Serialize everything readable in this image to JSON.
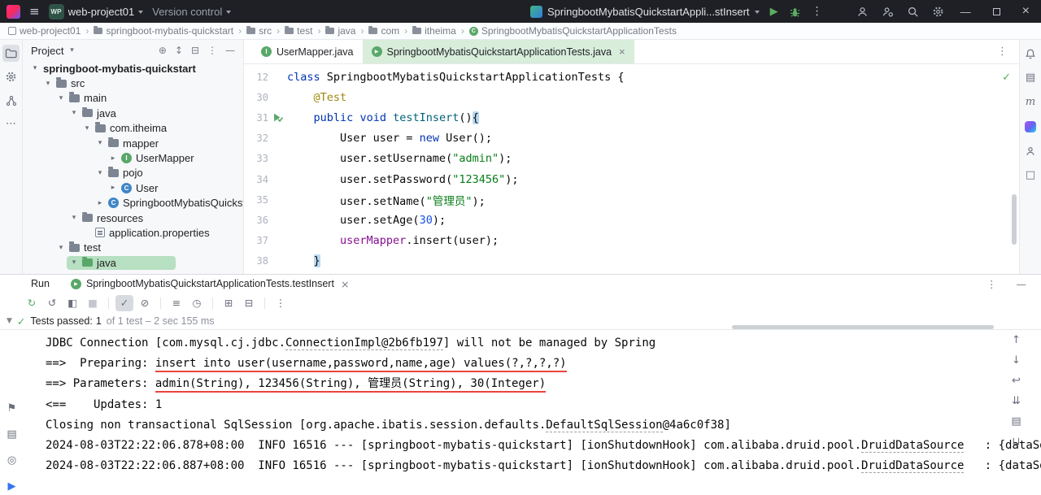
{
  "titlebar": {
    "project_badge": "WP",
    "project_name": "web-project01",
    "version_control": "Version control",
    "run_config": "SpringbootMybatisQuickstartAppli...stInsert"
  },
  "navbar": {
    "separator": "›",
    "items": [
      {
        "label": "web-project01",
        "icon": "project"
      },
      {
        "label": "springboot-mybatis-quickstart",
        "icon": "folder"
      },
      {
        "label": "src",
        "icon": "folder"
      },
      {
        "label": "test",
        "icon": "folder"
      },
      {
        "label": "java",
        "icon": "folder"
      },
      {
        "label": "com",
        "icon": "folder"
      },
      {
        "label": "itheima",
        "icon": "folder"
      },
      {
        "label": "SpringbootMybatisQuickstartApplicationTests",
        "icon": "class"
      }
    ]
  },
  "left_strip": [
    {
      "name": "project-tool",
      "active": true
    },
    {
      "name": "settings-tool"
    },
    {
      "name": "structure-tool"
    },
    {
      "name": "more-tools",
      "glyph": "⋯"
    }
  ],
  "bottom_rail": [
    {
      "name": "bookmarks",
      "glyph": "⚑"
    },
    {
      "name": "terminal",
      "glyph": "▤"
    },
    {
      "name": "services",
      "glyph": "◎"
    },
    {
      "name": "run-tool",
      "glyph": "▶",
      "cls": "blue"
    }
  ],
  "right_strip": [
    {
      "name": "notifications"
    },
    {
      "name": "layers",
      "glyph": "▤"
    },
    {
      "name": "maven",
      "glyph": "m",
      "cls": "serif"
    },
    {
      "name": "ai-assistant"
    },
    {
      "name": "profile"
    },
    {
      "name": "plugins",
      "glyph": "□"
    }
  ],
  "project": {
    "title": "Project",
    "header_icons": [
      {
        "name": "locate-file",
        "glyph": "⊕"
      },
      {
        "name": "expand-collapse",
        "glyph": "↕"
      },
      {
        "name": "collapse-all",
        "glyph": "⊟"
      },
      {
        "name": "more-options",
        "glyph": "⋮"
      },
      {
        "name": "hide-panel",
        "glyph": "—"
      }
    ],
    "tree": [
      {
        "label": "springboot-mybatis-quickstart",
        "indent": 0,
        "chevron": "open",
        "bold": true
      },
      {
        "label": "src",
        "indent": 1,
        "chevron": "open",
        "icon": "folder"
      },
      {
        "label": "main",
        "indent": 2,
        "chevron": "open",
        "icon": "folder"
      },
      {
        "label": "java",
        "indent": 3,
        "chevron": "open",
        "icon": "folder"
      },
      {
        "label": "com.itheima",
        "indent": 4,
        "chevron": "open",
        "icon": "folder"
      },
      {
        "label": "mapper",
        "indent": 5,
        "chevron": "open",
        "icon": "folder"
      },
      {
        "label": "UserMapper",
        "indent": 6,
        "chevron": "closed",
        "icon": "interface"
      },
      {
        "label": "pojo",
        "indent": 5,
        "chevron": "open",
        "icon": "folder"
      },
      {
        "label": "User",
        "indent": 6,
        "chevron": "closed",
        "icon": "class"
      },
      {
        "label": "SpringbootMybatisQuickst",
        "indent": 5,
        "chevron": "closed",
        "icon": "class"
      },
      {
        "label": "resources",
        "indent": 3,
        "chevron": "open",
        "icon": "folder"
      },
      {
        "label": "application.properties",
        "indent": 4,
        "icon": "properties"
      },
      {
        "label": "test",
        "indent": 2,
        "chevron": "open",
        "icon": "folder"
      },
      {
        "label": "java",
        "indent": 3,
        "chevron": "open",
        "icon": "folder-test",
        "selected": true
      }
    ]
  },
  "editor": {
    "tabs": [
      {
        "label": "UserMapper.java",
        "icon": "interface"
      },
      {
        "label": "SpringbootMybatisQuickstartApplicationTests.java",
        "icon": "testclass",
        "active": true,
        "close": "×"
      }
    ],
    "lines": [
      {
        "num": "12",
        "tokens": [
          {
            "t": "class",
            "c": "kw"
          },
          {
            "t": " SpringbootMybatisQuickstartApplicationTests {"
          }
        ]
      },
      {
        "num": "30",
        "tokens": [
          {
            "t": "    "
          },
          {
            "t": "@Test",
            "c": "ann"
          }
        ]
      },
      {
        "num": "31",
        "gutter": "run-pass",
        "tokens": [
          {
            "t": "    "
          },
          {
            "t": "public",
            "c": "kw"
          },
          {
            "t": " "
          },
          {
            "t": "void",
            "c": "kw"
          },
          {
            "t": " "
          },
          {
            "t": "testInsert",
            "c": "decl"
          },
          {
            "t": "()"
          },
          {
            "t": "{",
            "c": "hl"
          }
        ]
      },
      {
        "num": "32",
        "tokens": [
          {
            "t": "        User user = "
          },
          {
            "t": "new",
            "c": "kw"
          },
          {
            "t": " User();"
          }
        ]
      },
      {
        "num": "33",
        "tokens": [
          {
            "t": "        user.setUsername("
          },
          {
            "t": "\"admin\"",
            "c": "str"
          },
          {
            "t": ");"
          }
        ]
      },
      {
        "num": "34",
        "tokens": [
          {
            "t": "        user.setPassword("
          },
          {
            "t": "\"123456\"",
            "c": "str"
          },
          {
            "t": ");"
          }
        ]
      },
      {
        "num": "35",
        "tokens": [
          {
            "t": "        user.setName("
          },
          {
            "t": "\"管理员\"",
            "c": "str"
          },
          {
            "t": ");"
          }
        ]
      },
      {
        "num": "36",
        "tokens": [
          {
            "t": "        user.setAge("
          },
          {
            "t": "30",
            "c": "num"
          },
          {
            "t": ");"
          }
        ]
      },
      {
        "num": "37",
        "tokens": [
          {
            "t": "        "
          },
          {
            "t": "userMapper",
            "c": "field"
          },
          {
            "t": ".insert(user);"
          }
        ]
      },
      {
        "num": "38",
        "tokens": [
          {
            "t": "    "
          },
          {
            "t": "}",
            "c": "hl"
          }
        ]
      }
    ]
  },
  "run": {
    "label": "Run",
    "tab": "SpringbootMybatisQuickstartApplicationTests.testInsert",
    "tab_close": "×",
    "toolbar": [
      {
        "name": "rerun-tests",
        "glyph": "↻",
        "color": "#59a869"
      },
      {
        "name": "rerun-failed-tests",
        "glyph": "↺"
      },
      {
        "name": "run-with-coverage",
        "glyph": "◧"
      },
      {
        "name": "stop",
        "glyph": "■",
        "disabled": true
      },
      {
        "sep": true
      },
      {
        "name": "show-passed",
        "glyph": "✓",
        "active": true
      },
      {
        "name": "show-ignored",
        "glyph": "⊘"
      },
      {
        "sep": true
      },
      {
        "name": "sort-alphabetically",
        "glyph": "≡"
      },
      {
        "name": "sort-by-duration",
        "glyph": "◷"
      },
      {
        "sep": true
      },
      {
        "name": "expand-all",
        "glyph": "⊞"
      },
      {
        "name": "collapse-all",
        "glyph": "⊟"
      },
      {
        "sep": true
      },
      {
        "name": "more-options",
        "glyph": "⋮"
      }
    ],
    "status": {
      "main": "Tests passed:",
      "count": "1",
      "detail": "of 1 test – 2 sec 155 ms"
    },
    "console_rail": [
      {
        "name": "scroll-to-top",
        "glyph": "↑"
      },
      {
        "name": "scroll-to-bottom",
        "glyph": "↓"
      },
      {
        "name": "soft-wrap",
        "glyph": "↩"
      },
      {
        "name": "scroll-to-end",
        "glyph": "⇊"
      },
      {
        "name": "print",
        "glyph": "▤"
      },
      {
        "name": "clear-all",
        "glyph": "⊔"
      }
    ],
    "console": [
      {
        "tokens": [
          {
            "t": "JDBC Connection [com.mysql.cj.jdbc."
          },
          {
            "t": "ConnectionImpl@2b6fb197",
            "c": "spell"
          },
          {
            "t": "] will not be managed by Spring"
          }
        ]
      },
      {
        "tokens": [
          {
            "t": "==>  Preparing: "
          },
          {
            "t": "insert into user(username,password,name,age) values(?,?,?,?)",
            "c": "red"
          }
        ]
      },
      {
        "tokens": [
          {
            "t": "==> Parameters: "
          },
          {
            "t": "admin(String), 123456(String), 管理员(String), 30(Integer)",
            "c": "red"
          }
        ]
      },
      {
        "tokens": [
          {
            "t": "<==    Updates: 1"
          }
        ]
      },
      {
        "tokens": [
          {
            "t": "Closing non transactional SqlSession [org.apache.ibatis.session.defaults."
          },
          {
            "t": "DefaultSqlSession",
            "c": "spell"
          },
          {
            "t": "@4a6c0f38]"
          }
        ]
      },
      {
        "tokens": [
          {
            "t": "2024-08-03T22:22:06.878+08:00  INFO 16516 --- [springboot-mybatis-quickstart] [ionShutdownHook] com.alibaba.druid.pool."
          },
          {
            "t": "DruidDataSource",
            "c": "spell"
          },
          {
            "t": "   : {dataSou"
          }
        ]
      },
      {
        "tokens": [
          {
            "t": "2024-08-03T22:22:06.887+08:00  INFO 16516 --- [springboot-mybatis-quickstart] [ionShutdownHook] com.alibaba.druid.pool."
          },
          {
            "t": "DruidDataSource",
            "c": "spell"
          },
          {
            "t": "   : {dataSou"
          }
        ]
      }
    ]
  }
}
